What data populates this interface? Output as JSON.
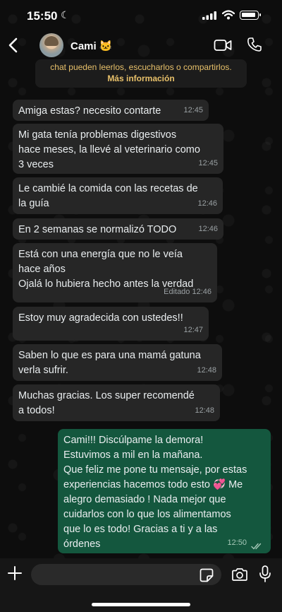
{
  "status_bar": {
    "time": "15:50"
  },
  "header": {
    "contact_name": "Cami 🐱"
  },
  "notice": {
    "text": "chat pueden leerlos, escucharlos o compartirlos.",
    "link": "Más información"
  },
  "messages": [
    {
      "direction": "in",
      "text": "Amiga estas? necesito contarte",
      "time": "12:45"
    },
    {
      "direction": "in",
      "text": "Mi gata tenía problemas digestivos\nhace meses, la llevé al veterinario como\n3 veces",
      "time": "12:45"
    },
    {
      "direction": "in",
      "text": "Le cambié la comida con las recetas de\nla guía",
      "time": "12:46"
    },
    {
      "direction": "in",
      "text": "En 2 semanas se normalizó TODO",
      "time": "12:46"
    },
    {
      "direction": "in",
      "text": "Está con una energía que no le veía\nhace años\nOjalá lo hubiera hecho antes la verdad",
      "time": "Editado 12:46"
    },
    {
      "direction": "in",
      "text": "Estoy muy agradecida con ustedes!!",
      "time": "12:47"
    },
    {
      "direction": "in",
      "text": "Saben lo que es para una mamá gatuna\nverla sufrir.",
      "time": "12:48"
    },
    {
      "direction": "in",
      "text": "Muchas gracias. Los super recomendé\na todos!",
      "time": "12:48"
    },
    {
      "direction": "out",
      "text": "Cami!!! Discúlpame la demora!\nEstuvimos a mil en la mañana.\nQue feliz me pone tu mensaje, por estas\nexperiencias hacemos todo esto 💞 Me\nalegro demasiado ! Nada mejor que\ncuidarlos con lo que los alimentamos\nque lo es todo! Gracias a ti y a las\nórdenes",
      "time": "12:50"
    }
  ],
  "composer": {
    "value": "",
    "placeholder": ""
  },
  "colors": {
    "incoming_bubble": "#262626",
    "outgoing_bubble": "#14573e",
    "notice_text": "#e7c06a"
  },
  "icons": [
    "back-icon",
    "video-call-icon",
    "phone-icon",
    "plus-icon",
    "sticker-icon",
    "camera-icon",
    "microphone-icon",
    "double-check-icon"
  ]
}
